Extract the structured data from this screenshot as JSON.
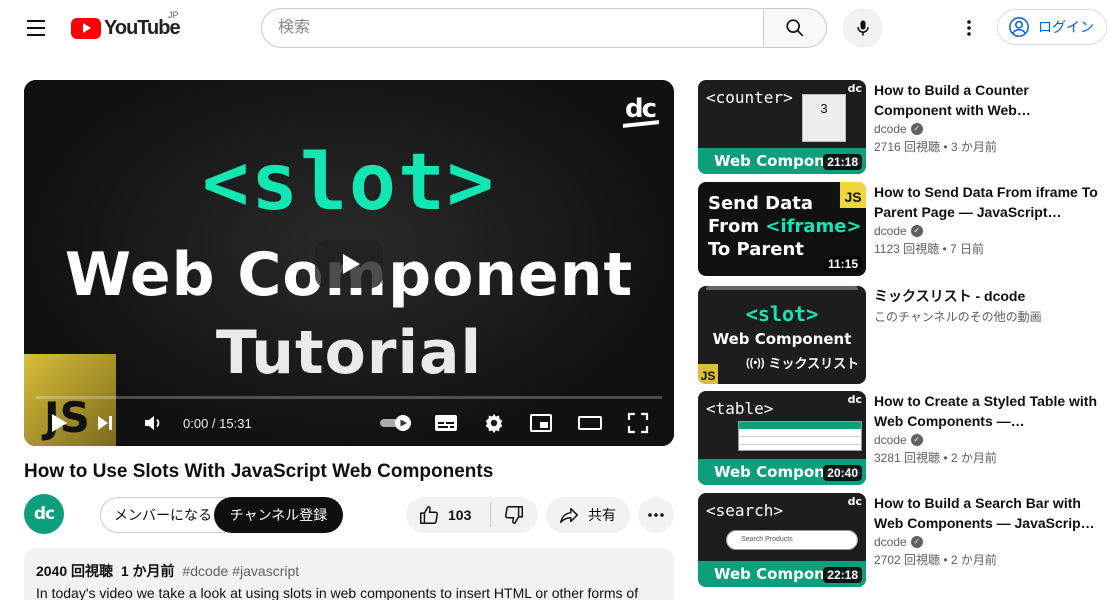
{
  "header": {
    "logo_text": "YouTube",
    "country": "JP",
    "search_placeholder": "検索",
    "login_label": "ログイン"
  },
  "player": {
    "time": "0:00 / 15:31",
    "progress": 0,
    "overlay_code": "<slot>",
    "overlay_line1": "Web Component",
    "overlay_line2": "Tutorial",
    "overlay_badge": "JS",
    "channel_mark": "dc"
  },
  "video": {
    "title": "How to Use Slots With JavaScript Web Components",
    "channel_avatar": "dc",
    "member_label": "メンバーになる",
    "subscribe_label": "チャンネル登録",
    "likes": "103",
    "share_label": "共有",
    "views": "2040 回視聴",
    "date": "1 か月前",
    "tags": "#dcode #javascript",
    "description": "In today's video we take a look at using slots in web components to insert HTML or other forms of"
  },
  "recommendations": [
    {
      "title": "How to Build a Counter Component with Web…",
      "channel": "dcode",
      "views": "2716 回視聴",
      "age": "3 か月前",
      "duration": "21:18",
      "thumb_code": "<counter>",
      "thumb_band": "Web Components",
      "thumb_num": "3"
    },
    {
      "title": "How to Send Data From iframe To Parent Page — JavaScript…",
      "channel": "dcode",
      "views": "1123 回視聴",
      "age": "7 日前",
      "duration": "11:15",
      "thumb_l1": "Send Data",
      "thumb_l2a": "From ",
      "thumb_l2b": "<iframe>",
      "thumb_l3": "To Parent",
      "thumb_badge": "JS"
    },
    {
      "title": "ミックスリスト - dcode",
      "subtitle": "このチャンネルのその他の動画",
      "thumb_code": "<slot>",
      "thumb_line": "Web Component",
      "thumb_mix": "ミックスリスト",
      "thumb_badge": "JS"
    },
    {
      "title": "How to Create a Styled Table with Web Components —…",
      "channel": "dcode",
      "views": "3281 回視聴",
      "age": "2 か月前",
      "duration": "20:40",
      "thumb_code": "<table>",
      "thumb_band": "Web Components"
    },
    {
      "title": "How to Build a Search Bar with Web Components — JavaScrip…",
      "channel": "dcode",
      "views": "2702 回視聴",
      "age": "2 か月前",
      "duration": "22:18",
      "thumb_code": "<search>",
      "thumb_band": "Web Components",
      "thumb_search_placeholder": "Search Products"
    }
  ],
  "colors": {
    "brand_red": "#ff0000",
    "accent_teal": "#0d9e7c",
    "neon_teal": "#12e6b3",
    "link_blue": "#065fd4"
  },
  "icons": [
    "menu-icon",
    "search-icon",
    "mic-icon",
    "more-vert-icon",
    "account-icon",
    "play-icon",
    "next-icon",
    "volume-icon",
    "autoplay-toggle",
    "subtitles-icon",
    "settings-icon",
    "miniplayer-icon",
    "theater-icon",
    "fullscreen-icon",
    "like-icon",
    "dislike-icon",
    "share-icon",
    "more-horiz-icon",
    "verified-icon"
  ]
}
